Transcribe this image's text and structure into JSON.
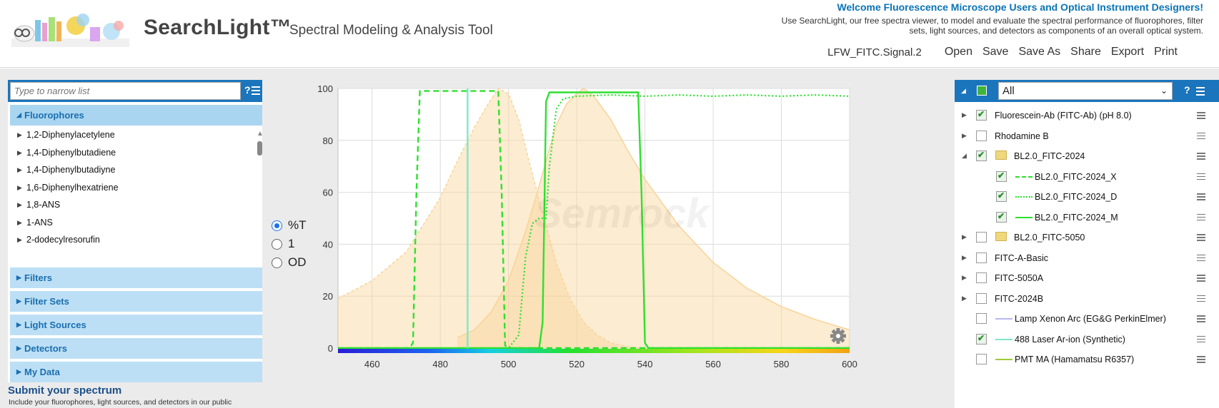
{
  "header": {
    "title": "SearchLight™",
    "subtitle": "Spectral Modeling & Analysis Tool",
    "welcome": "Welcome Fluorescence Microscope Users and Optical Instrument Designers!",
    "welcome_desc": "Use SearchLight, our free spectra viewer, to model and evaluate the spectral performance of fluorophores, filter sets, light sources, and detectors as components of an overall optical system.",
    "document_name": "LFW_FITC.Signal.2",
    "menu": [
      "Open",
      "Save",
      "Save As",
      "Share",
      "Export",
      "Print"
    ]
  },
  "left": {
    "search_placeholder": "Type to narrow list",
    "help": "?",
    "open_category": "Fluorophores",
    "items": [
      "1,2-Diphenylacetylene",
      "1,4-Diphenylbutadiene",
      "1,4-Diphenylbutadiyne",
      "1,6-Diphenylhexatriene",
      "1,8-ANS",
      "1-ANS",
      "2-dodecylresorufin"
    ],
    "categories": [
      "Filters",
      "Filter Sets",
      "Light Sources",
      "Detectors",
      "My Data"
    ],
    "submit_title": "Submit your spectrum",
    "submit_desc": "Include your fluorophores, light sources, and detectors in our public"
  },
  "radio": {
    "options": [
      "%T",
      "1",
      "OD"
    ],
    "selected": "%T"
  },
  "right": {
    "filter_value": "All",
    "help": "?",
    "layers": [
      {
        "label": "Fluorescein-Ab (FITC-Ab) (pH 8.0)",
        "checked": true,
        "level": 0,
        "expander": "closed"
      },
      {
        "label": "Rhodamine B",
        "checked": false,
        "level": 0,
        "expander": "closed"
      },
      {
        "label": "BL2.0_FITC-2024",
        "checked": true,
        "level": 0,
        "expander": "open",
        "folder": true
      },
      {
        "label": "BL2.0_FITC-2024_X",
        "checked": true,
        "level": 1,
        "line": "dashed",
        "color": "#2ee02e"
      },
      {
        "label": "BL2.0_FITC-2024_D",
        "checked": true,
        "level": 1,
        "line": "dotted",
        "color": "#2ee02e"
      },
      {
        "label": "BL2.0_FITC-2024_M",
        "checked": true,
        "level": 1,
        "line": "solid",
        "color": "#2ee02e"
      },
      {
        "label": "BL2.0_FITC-5050",
        "checked": false,
        "level": 0,
        "expander": "closed",
        "folder": true
      },
      {
        "label": "FITC-A-Basic",
        "checked": false,
        "level": 0,
        "expander": "closed"
      },
      {
        "label": "FITC-5050A",
        "checked": false,
        "level": 0,
        "expander": "closed"
      },
      {
        "label": "FITC-2024B",
        "checked": false,
        "level": 0,
        "expander": "closed"
      },
      {
        "label": "Lamp Xenon Arc (EG&G PerkinElmer)",
        "checked": false,
        "level": 0,
        "line": "solid",
        "color": "#b7b7ef"
      },
      {
        "label": "488 Laser Ar-ion (Synthetic)",
        "checked": true,
        "level": 0,
        "line": "solid",
        "color": "#7fe8c8"
      },
      {
        "label": "PMT MA (Hamamatsu R6357)",
        "checked": false,
        "level": 0,
        "line": "solid",
        "color": "#9ecb3a"
      }
    ]
  },
  "chart_data": {
    "type": "line",
    "watermark": "Semrock",
    "xlim": [
      450,
      600
    ],
    "ylim": [
      0,
      100
    ],
    "x_ticks": [
      460,
      480,
      500,
      520,
      540,
      560,
      580,
      600
    ],
    "y_ticks": [
      0,
      20,
      40,
      60,
      80,
      100
    ],
    "grid": true,
    "series": [
      {
        "name": "Fluorescein-Ab (FITC-Ab) (pH 8.0) excitation",
        "style": "area-dashed",
        "color": "#f8d49a",
        "points": [
          [
            450,
            19
          ],
          [
            460,
            26
          ],
          [
            470,
            37
          ],
          [
            480,
            58
          ],
          [
            485,
            72
          ],
          [
            490,
            85
          ],
          [
            494,
            94
          ],
          [
            497,
            100
          ],
          [
            500,
            98
          ],
          [
            503,
            88
          ],
          [
            506,
            72
          ],
          [
            510,
            52
          ],
          [
            514,
            33
          ],
          [
            518,
            19
          ],
          [
            522,
            10
          ],
          [
            526,
            5
          ],
          [
            530,
            2
          ],
          [
            535,
            0.5
          ],
          [
            540,
            0
          ]
        ]
      },
      {
        "name": "Fluorescein-Ab (FITC-Ab) (pH 8.0) emission",
        "style": "area-solid",
        "color": "#f8d49a",
        "points": [
          [
            485,
            4
          ],
          [
            490,
            7
          ],
          [
            495,
            14
          ],
          [
            500,
            26
          ],
          [
            505,
            45
          ],
          [
            508,
            58
          ],
          [
            511,
            72
          ],
          [
            514,
            86
          ],
          [
            517,
            94
          ],
          [
            520,
            98
          ],
          [
            522,
            100
          ],
          [
            525,
            97
          ],
          [
            530,
            88
          ],
          [
            535,
            76
          ],
          [
            540,
            65
          ],
          [
            550,
            47
          ],
          [
            560,
            33
          ],
          [
            570,
            23
          ],
          [
            580,
            16
          ],
          [
            590,
            11
          ],
          [
            600,
            7
          ]
        ]
      },
      {
        "name": "BL2.0_FITC-2024_X",
        "style": "dashed",
        "color": "#2ee02e",
        "points": [
          [
            450,
            0
          ],
          [
            471,
            0
          ],
          [
            472,
            2
          ],
          [
            473,
            60
          ],
          [
            474,
            99
          ],
          [
            497,
            99
          ],
          [
            498,
            60
          ],
          [
            499,
            1
          ],
          [
            500,
            0
          ],
          [
            600,
            0
          ]
        ]
      },
      {
        "name": "BL2.0_FITC-2024_D",
        "style": "dotted",
        "color": "#2ee02e",
        "points": [
          [
            450,
            0
          ],
          [
            500,
            0
          ],
          [
            503,
            5
          ],
          [
            505,
            35
          ],
          [
            507,
            48
          ],
          [
            509,
            50
          ],
          [
            511,
            50
          ],
          [
            512,
            70
          ],
          [
            514,
            92
          ],
          [
            516,
            96
          ],
          [
            520,
            97
          ],
          [
            530,
            97.5
          ],
          [
            540,
            97
          ],
          [
            550,
            97.5
          ],
          [
            560,
            97
          ],
          [
            570,
            97.5
          ],
          [
            580,
            97
          ],
          [
            590,
            97.5
          ],
          [
            600,
            97
          ]
        ]
      },
      {
        "name": "BL2.0_FITC-2024_M",
        "style": "solid",
        "color": "#2ee02e",
        "points": [
          [
            450,
            0
          ],
          [
            509,
            0
          ],
          [
            510,
            10
          ],
          [
            511,
            95
          ],
          [
            512,
            98.5
          ],
          [
            538,
            98.5
          ],
          [
            539,
            60
          ],
          [
            540,
            2
          ],
          [
            541,
            0
          ],
          [
            600,
            0
          ]
        ]
      },
      {
        "name": "488 Laser Ar-ion (Synthetic)",
        "style": "solid",
        "color": "#7fe8c8",
        "points": [
          [
            488,
            0
          ],
          [
            488,
            100
          ]
        ]
      }
    ]
  }
}
